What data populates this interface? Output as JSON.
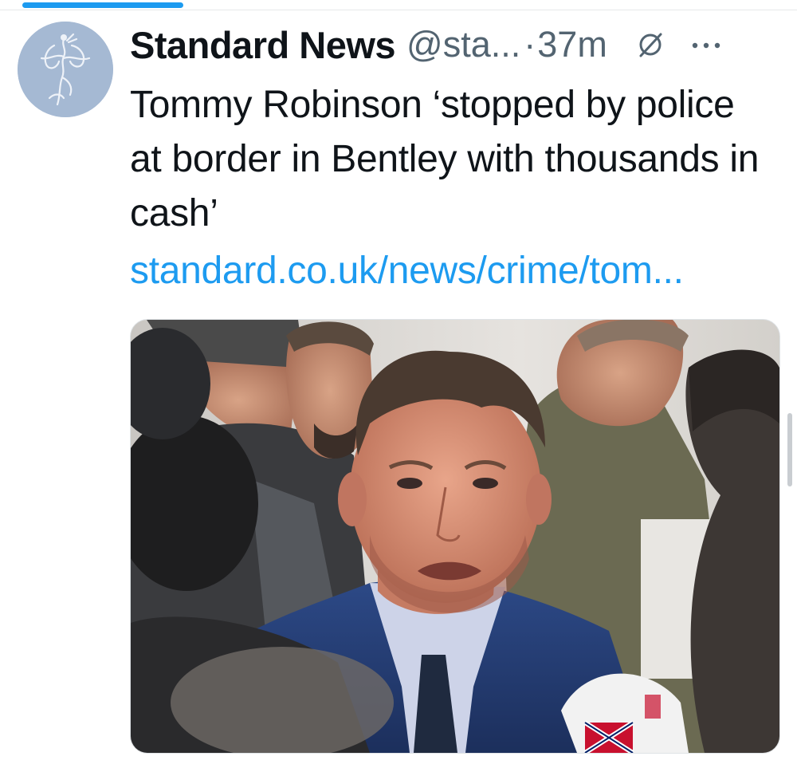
{
  "tweet": {
    "display_name": "Standard News",
    "handle": "@sta...",
    "separator": "·",
    "time": "37m",
    "text": "Tommy Robinson ‘stopped by police at border in Bentley with thousands in cash’",
    "link": "standard.co.uk/news/crime/tom..."
  },
  "icons": {
    "avatar": "angel-statue-avatar",
    "mute": "mute-icon",
    "more": "more-dots-icon"
  },
  "colors": {
    "accent": "#1d9bf0",
    "text": "#0f1419",
    "secondary": "#536471",
    "avatar_bg": "#a5b9d3"
  }
}
